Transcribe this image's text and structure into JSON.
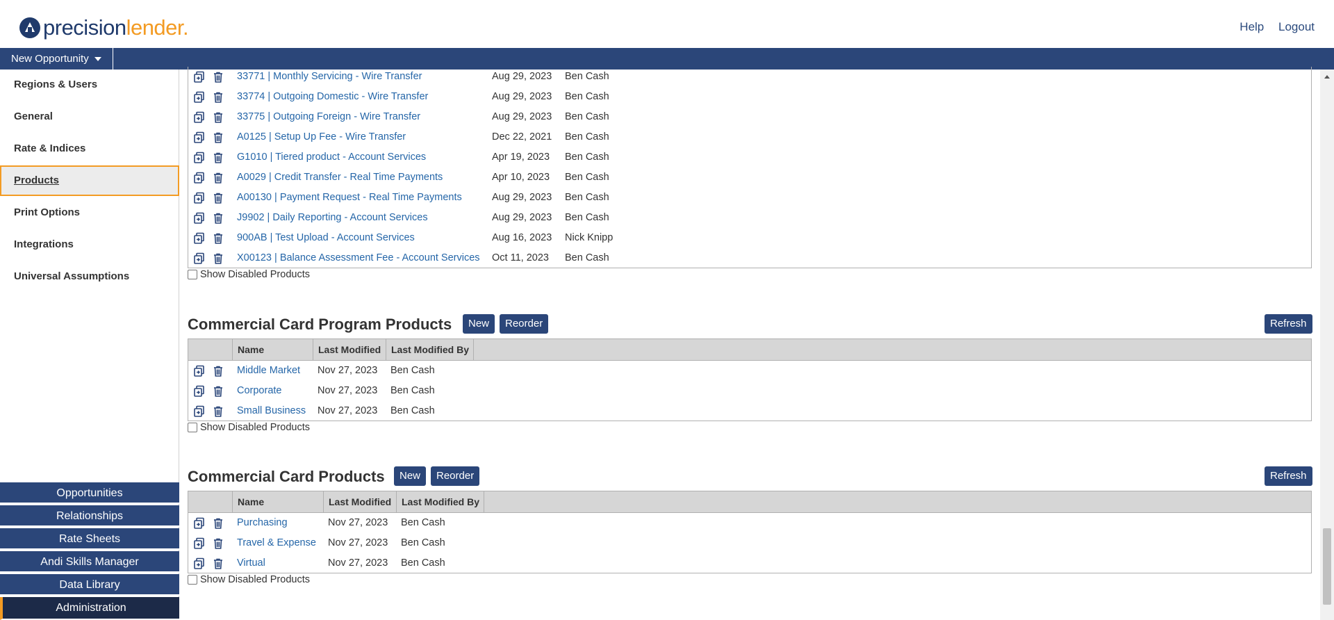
{
  "brand": {
    "part1": "precision",
    "part2": "lender",
    "dot": "."
  },
  "header_links": {
    "help": "Help",
    "logout": "Logout"
  },
  "topnav": {
    "new_opportunity": "New Opportunity"
  },
  "sidebar": {
    "items": [
      {
        "label": "Regions & Users"
      },
      {
        "label": "General"
      },
      {
        "label": "Rate & Indices"
      },
      {
        "label": "Products"
      },
      {
        "label": "Print Options"
      },
      {
        "label": "Integrations"
      },
      {
        "label": "Universal Assumptions"
      }
    ],
    "active": "Products",
    "bottom_nav": [
      {
        "label": "Opportunities"
      },
      {
        "label": "Relationships"
      },
      {
        "label": "Rate Sheets"
      },
      {
        "label": "Andi Skills Manager"
      },
      {
        "label": "Data Library"
      },
      {
        "label": "Administration"
      }
    ]
  },
  "top_table": {
    "rows": [
      {
        "name": "33771 | Monthly Servicing - Wire Transfer",
        "modified": "Aug 29, 2023",
        "by": "Ben Cash"
      },
      {
        "name": "33774 | Outgoing Domestic - Wire Transfer",
        "modified": "Aug 29, 2023",
        "by": "Ben Cash"
      },
      {
        "name": "33775 | Outgoing Foreign - Wire Transfer",
        "modified": "Aug 29, 2023",
        "by": "Ben Cash"
      },
      {
        "name": "A0125 | Setup Up Fee - Wire Transfer",
        "modified": "Dec 22, 2021",
        "by": "Ben Cash"
      },
      {
        "name": "G1010 | Tiered product - Account Services",
        "modified": "Apr 19, 2023",
        "by": "Ben Cash"
      },
      {
        "name": "A0029 | Credit Transfer - Real Time Payments",
        "modified": "Apr 10, 2023",
        "by": "Ben Cash"
      },
      {
        "name": "A00130 | Payment Request - Real Time Payments",
        "modified": "Aug 29, 2023",
        "by": "Ben Cash"
      },
      {
        "name": "J9902 | Daily Reporting - Account Services",
        "modified": "Aug 29, 2023",
        "by": "Ben Cash"
      },
      {
        "name": "900AB | Test Upload - Account Services",
        "modified": "Aug 16, 2023",
        "by": "Nick Knipp"
      },
      {
        "name": "X00123 | Balance Assessment Fee - Account Services",
        "modified": "Oct 11, 2023",
        "by": "Ben Cash"
      }
    ],
    "show_disabled": "Show Disabled Products"
  },
  "ccp": {
    "title": "Commercial Card Program Products",
    "new_btn": "New",
    "reorder_btn": "Reorder",
    "refresh_btn": "Refresh",
    "columns": {
      "name": "Name",
      "modified": "Last Modified",
      "by": "Last Modified By"
    },
    "rows": [
      {
        "name": "Middle Market",
        "modified": "Nov 27, 2023",
        "by": "Ben Cash"
      },
      {
        "name": "Corporate",
        "modified": "Nov 27, 2023",
        "by": "Ben Cash"
      },
      {
        "name": "Small Business",
        "modified": "Nov 27, 2023",
        "by": "Ben Cash"
      }
    ],
    "show_disabled": "Show Disabled Products"
  },
  "cc": {
    "title": "Commercial Card Products",
    "new_btn": "New",
    "reorder_btn": "Reorder",
    "refresh_btn": "Refresh",
    "columns": {
      "name": "Name",
      "modified": "Last Modified",
      "by": "Last Modified By"
    },
    "rows": [
      {
        "name": "Purchasing",
        "modified": "Nov 27, 2023",
        "by": "Ben Cash"
      },
      {
        "name": "Travel & Expense",
        "modified": "Nov 27, 2023",
        "by": "Ben Cash"
      },
      {
        "name": "Virtual",
        "modified": "Nov 27, 2023",
        "by": "Ben Cash"
      }
    ],
    "show_disabled": "Show Disabled Products"
  },
  "colors": {
    "accent": "#f39b23",
    "nav": "#2b4679",
    "link": "#2566a8"
  }
}
